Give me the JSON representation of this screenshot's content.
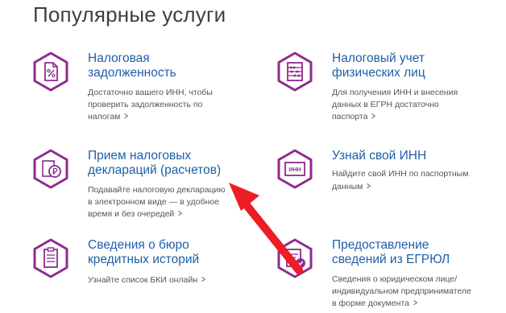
{
  "page": {
    "title": "Популярные услуги"
  },
  "colors": {
    "icon": "#8e2b8e",
    "link": "#1f5fa8",
    "arrow": "#ee1c24"
  },
  "services": [
    {
      "icon": "document-percent-icon",
      "title_l1": "Налоговая",
      "title_l2": "задолженность",
      "desc_l1": "Достаточно вашего ИНН, чтобы",
      "desc_l2": "проверить задолженность по",
      "desc_l3": "налогам"
    },
    {
      "icon": "abacus-icon",
      "title_l1": "Налоговый учет",
      "title_l2": "физических лиц",
      "desc_l1": "Для получения ИНН и внесения",
      "desc_l2": "данных в ЕГРН достаточно",
      "desc_l3": "паспорта"
    },
    {
      "icon": "ruble-document-icon",
      "title_l1": "Прием налоговых",
      "title_l2": "деклараций (расчетов)",
      "desc_l1": "Подавайте налоговую декларацию",
      "desc_l2": "в электронном виде — в удобное",
      "desc_l3": "время и без очередей"
    },
    {
      "icon": "inn-card-icon",
      "title_l1": "Узнай свой ИНН",
      "desc_l1": "Найдите свой ИНН по паспортным",
      "desc_l2": "данным"
    },
    {
      "icon": "checklist-icon",
      "title_l1": "Сведения о бюро",
      "title_l2": "кредитных историй",
      "desc_l1": "Узнайте список БКИ онлайн"
    },
    {
      "icon": "egrul-check-icon",
      "title_l1": "Предоставление",
      "title_l2": "сведений из ЕГРЮЛ",
      "desc_l1": "Сведения о юридическом лице/",
      "desc_l2": "индивидуальном предпринимателе",
      "desc_l3": "в форме документа"
    }
  ]
}
